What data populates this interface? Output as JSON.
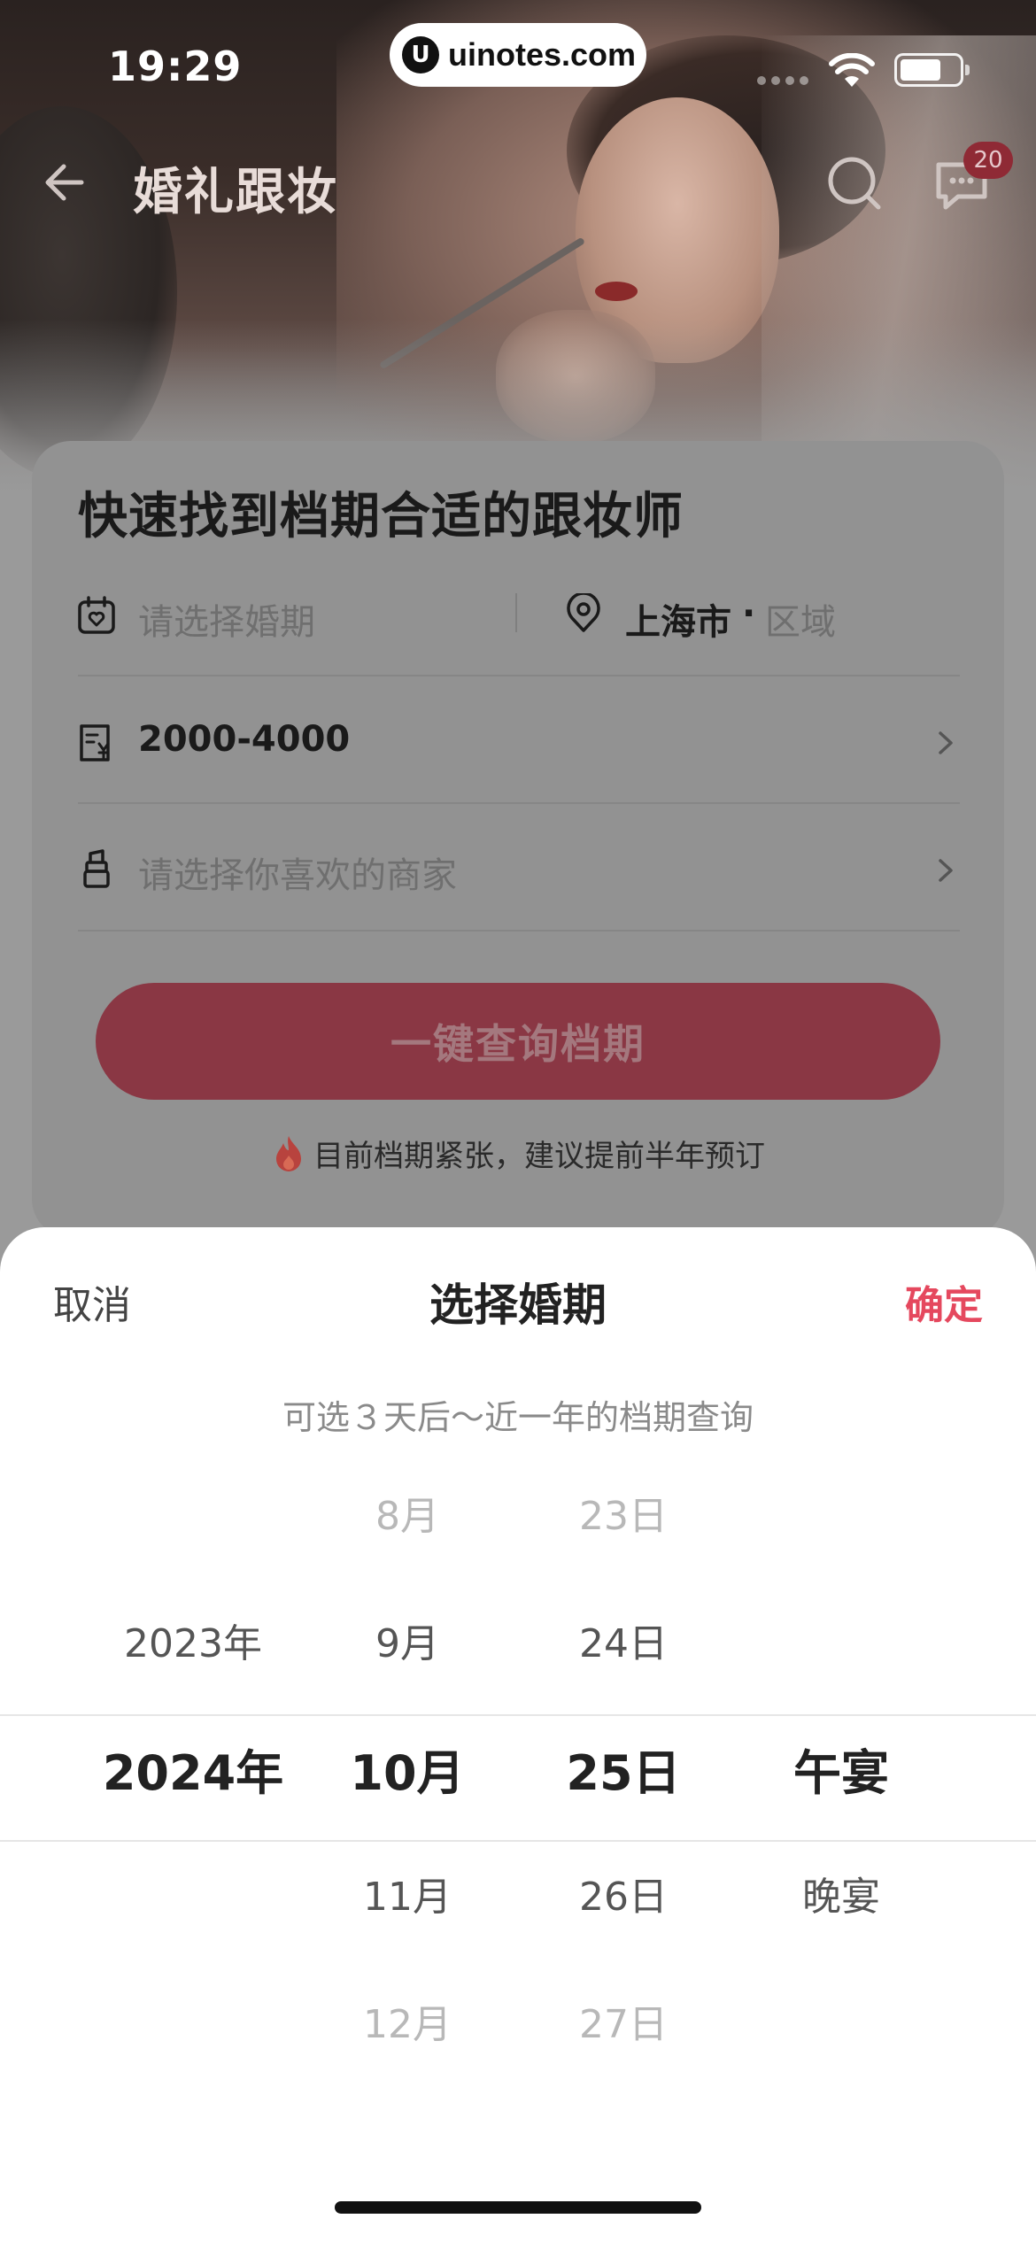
{
  "status_bar": {
    "time": "19:29",
    "url": "uinotes.com",
    "url_logo": "U"
  },
  "nav": {
    "title": "婚礼跟妆",
    "badge_count": "20"
  },
  "card": {
    "title": "快速找到档期合适的跟妆师",
    "date_placeholder": "请选择婚期",
    "city": "上海市",
    "district": "区域",
    "budget": "2000-4000",
    "merchant_placeholder": "请选择你喜欢的商家",
    "query_button": "一键查询档期",
    "tip": "目前档期紧张，建议提前半年预订"
  },
  "sheet": {
    "cancel": "取消",
    "title": "选择婚期",
    "confirm": "确定",
    "hint": "可选３天后～近一年的档期查询",
    "years": [
      "",
      "2023年",
      "2024年",
      "",
      ""
    ],
    "months": [
      "8月",
      "9月",
      "10月",
      "11月",
      "12月"
    ],
    "days": [
      "23日",
      "24日",
      "25日",
      "26日",
      "27日"
    ],
    "meals": [
      "",
      "",
      "午宴",
      "晚宴",
      ""
    ]
  },
  "colors": {
    "accent": "#e5485e",
    "button_dimmed": "#8a3744",
    "badge": "#8f2a35"
  }
}
